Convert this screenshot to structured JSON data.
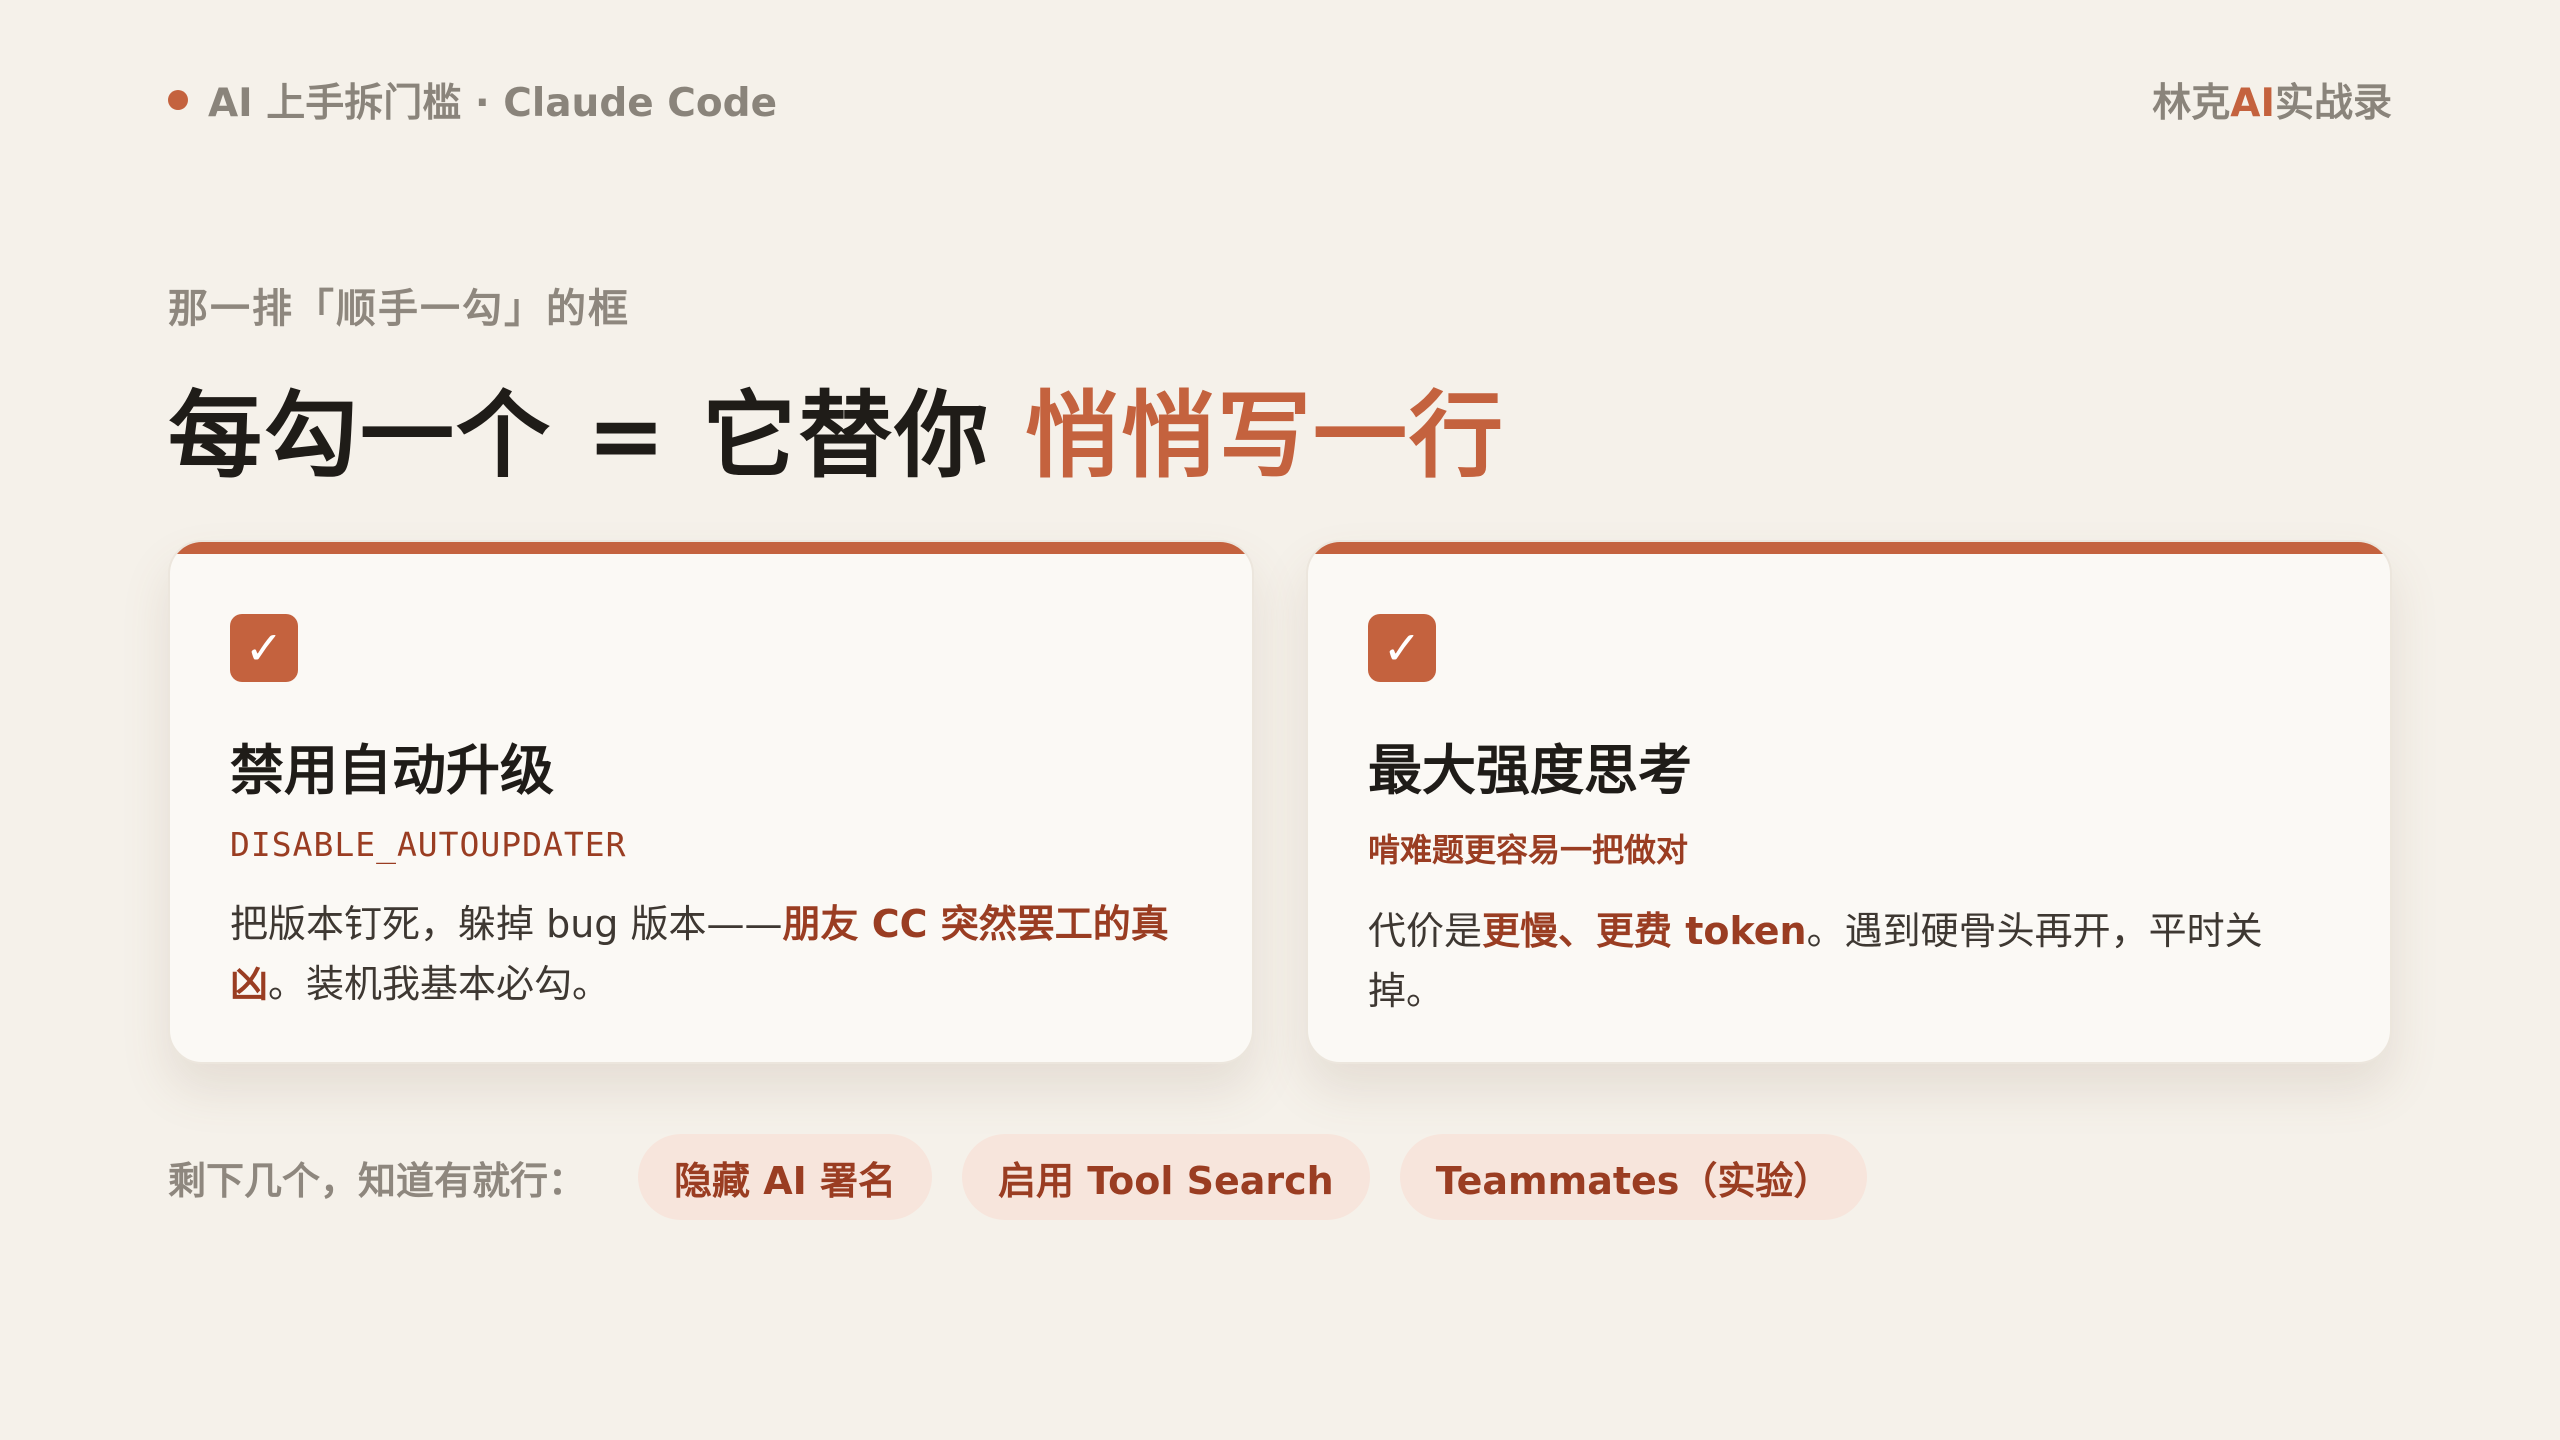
{
  "header": {
    "course": "AI 上手拆门槛 · Claude Code",
    "brand_prefix": "林克",
    "brand_accent": "AI",
    "brand_suffix": "实战录"
  },
  "eyebrow": "那一排「顺手一勾」的框",
  "headline": {
    "main": "每勾一个 = 它替你 ",
    "highlight": "悄悄写一行"
  },
  "cards": [
    {
      "check": "✓",
      "title": "禁用自动升级",
      "subtitle": "DISABLE_AUTOUPDATER",
      "body_1": "把版本钉死，躲掉 bug 版本——",
      "body_em_1": "朋友 CC 突然罢工的真凶",
      "body_2": "。装机我基本必勾。"
    },
    {
      "check": "✓",
      "title": "最大强度思考",
      "subtitle": "啃难题更容易一把做对",
      "body_1": "代价是",
      "body_em_1": "更慢、更费 token",
      "body_2": "。遇到硬骨头再开，平时关掉。"
    }
  ],
  "bottom": {
    "label": "剩下几个，知道有就行：",
    "chips": [
      "隐藏 AI 署名",
      "启用 Tool Search",
      "Teammates（实验）"
    ]
  },
  "colors": {
    "accent": "#c4623e",
    "accent_dark": "#9a3d22",
    "background": "#f5f1ea",
    "chip_bg": "#f7e5dc"
  }
}
